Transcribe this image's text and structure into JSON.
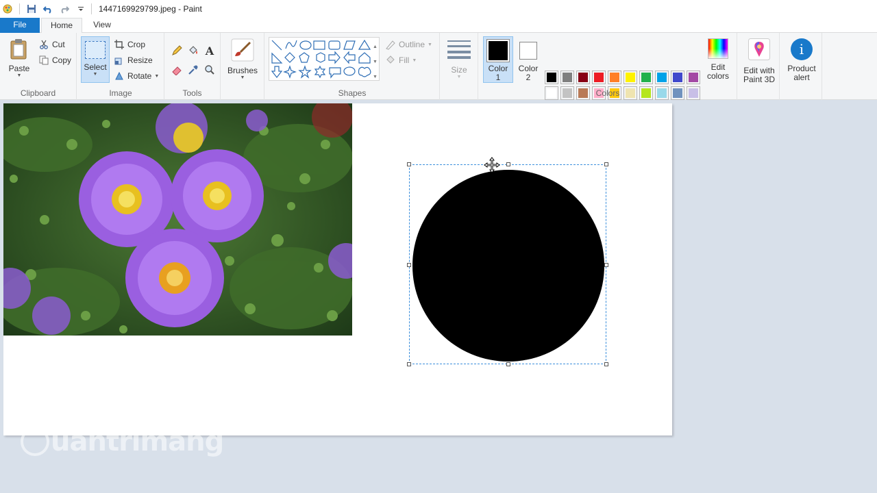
{
  "window": {
    "title": "1447169929799.jpeg - Paint"
  },
  "tabs": [
    {
      "label": "File"
    },
    {
      "label": "Home"
    },
    {
      "label": "View"
    }
  ],
  "ribbon": {
    "clipboard": {
      "label": "Clipboard",
      "paste": "Paste",
      "cut": "Cut",
      "copy": "Copy"
    },
    "image": {
      "label": "Image",
      "select": "Select",
      "crop": "Crop",
      "resize": "Resize",
      "rotate": "Rotate"
    },
    "tools": {
      "label": "Tools"
    },
    "brushes": {
      "label": "Brushes"
    },
    "shapes": {
      "label": "Shapes",
      "outline": "Outline",
      "fill": "Fill"
    },
    "size": {
      "label": "Size"
    },
    "colors": {
      "label": "Colors",
      "color1_line1": "Color",
      "color1_line2": "1",
      "color2_line1": "Color",
      "color2_line2": "2",
      "color1_value": "#000000",
      "color2_value": "#ffffff",
      "row1": [
        "#000000",
        "#7f7f7f",
        "#880015",
        "#ed1c24",
        "#ff7f27",
        "#fff200",
        "#22b14c",
        "#00a2e8",
        "#3f48cc",
        "#a349a4"
      ],
      "row2": [
        "#ffffff",
        "#c3c3c3",
        "#b97a57",
        "#ffaec9",
        "#ffc90e",
        "#efe4b0",
        "#b5e61d",
        "#99d9ea",
        "#7092be",
        "#c8bfe7"
      ],
      "edit_line1": "Edit",
      "edit_line2": "colors"
    },
    "paint3d": {
      "line1": "Edit with",
      "line2": "Paint 3D"
    },
    "product_alert": {
      "line1": "Product",
      "line2": "alert"
    }
  },
  "watermark": "uantrimang"
}
